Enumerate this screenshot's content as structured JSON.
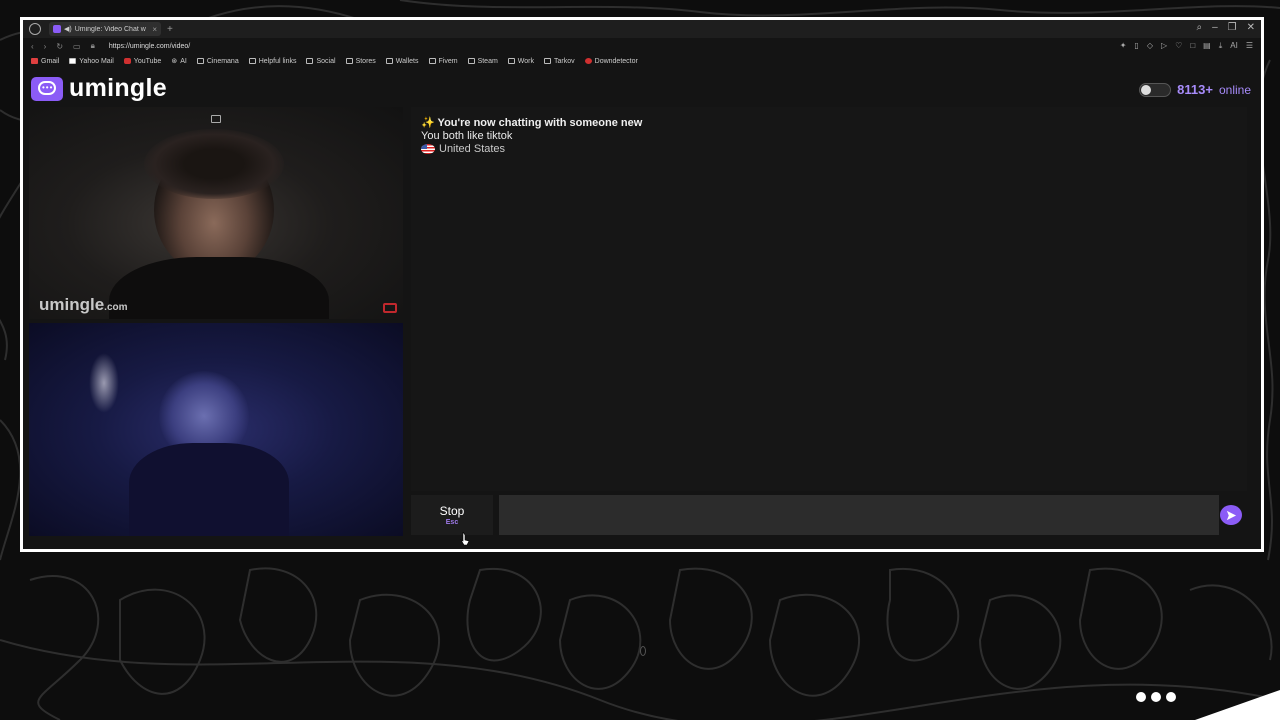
{
  "browser": {
    "tab_title": "Umingle: Video Chat w",
    "url": "https://umingle.com/video/",
    "bookmarks": [
      "Gmail",
      "Yahoo Mail",
      "YouTube",
      "AI",
      "Cinemana",
      "Helpful links",
      "Social",
      "Stores",
      "Wallets",
      "Fivem",
      "Steam",
      "Work",
      "Tarkov",
      "Downdetector"
    ]
  },
  "app": {
    "logo_text": "umingle",
    "online_count": "8113+",
    "online_label": "online",
    "watermark_main": "umingle",
    "watermark_suffix": ".com"
  },
  "chat": {
    "line1": "✨ You're now chatting with someone new",
    "line2": "You both like tiktok",
    "country": "United States"
  },
  "controls": {
    "stop_label": "Stop",
    "stop_key": "Esc",
    "message_placeholder": ""
  },
  "colors": {
    "accent": "#8b5cf6",
    "online_text": "#a78bfa"
  }
}
